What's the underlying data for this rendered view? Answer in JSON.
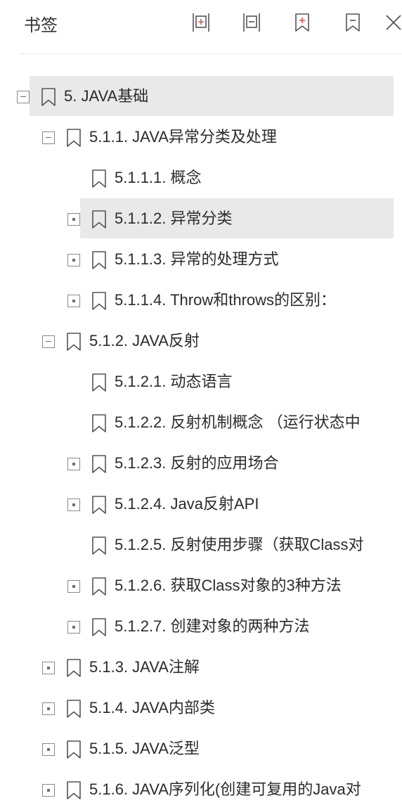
{
  "panel": {
    "title": "书签"
  },
  "toolbar": {
    "icons": [
      "expand-all-icon",
      "collapse-all-icon",
      "add-bookmark-icon",
      "delete-bookmark-icon",
      "close-icon"
    ]
  },
  "tree": [
    {
      "label": "5. JAVA基础",
      "level": 0,
      "toggle": "expanded",
      "highlighted": true
    },
    {
      "label": "5.1.1. JAVA异常分类及处理",
      "level": 1,
      "toggle": "expanded",
      "highlighted": false
    },
    {
      "label": "5.1.1.1. 概念",
      "level": 2,
      "toggle": "none",
      "highlighted": false
    },
    {
      "label": "5.1.1.2. 异常分类",
      "level": 2,
      "toggle": "collapsed",
      "highlighted": true
    },
    {
      "label": "5.1.1.3. 异常的处理方式",
      "level": 2,
      "toggle": "collapsed",
      "highlighted": false
    },
    {
      "label": "5.1.1.4. Throw和throws的区别：",
      "level": 2,
      "toggle": "collapsed",
      "highlighted": false
    },
    {
      "label": "5.1.2. JAVA反射",
      "level": 1,
      "toggle": "expanded",
      "highlighted": false
    },
    {
      "label": "5.1.2.1. 动态语言",
      "level": 2,
      "toggle": "none",
      "highlighted": false
    },
    {
      "label": "5.1.2.2. 反射机制概念 （运行状态中",
      "level": 2,
      "toggle": "none",
      "highlighted": false
    },
    {
      "label": "5.1.2.3. 反射的应用场合",
      "level": 2,
      "toggle": "collapsed",
      "highlighted": false
    },
    {
      "label": "5.1.2.4. Java反射API",
      "level": 2,
      "toggle": "collapsed",
      "highlighted": false
    },
    {
      "label": "5.1.2.5. 反射使用步骤（获取Class对",
      "level": 2,
      "toggle": "none",
      "highlighted": false
    },
    {
      "label": "5.1.2.6. 获取Class对象的3种方法",
      "level": 2,
      "toggle": "collapsed",
      "highlighted": false
    },
    {
      "label": "5.1.2.7. 创建对象的两种方法",
      "level": 2,
      "toggle": "collapsed",
      "highlighted": false
    },
    {
      "label": "5.1.3. JAVA注解",
      "level": 1,
      "toggle": "collapsed",
      "highlighted": false
    },
    {
      "label": "5.1.4. JAVA内部类",
      "level": 1,
      "toggle": "collapsed",
      "highlighted": false
    },
    {
      "label": "5.1.5. JAVA泛型",
      "level": 1,
      "toggle": "collapsed",
      "highlighted": false
    },
    {
      "label": "5.1.6. JAVA序列化(创建可复用的Java对",
      "level": 1,
      "toggle": "collapsed",
      "highlighted": false
    }
  ],
  "colors": {
    "highlight": "#e9e9e9",
    "icon_stroke": "#555555",
    "bookmark_add_accent": "#d9534f"
  }
}
